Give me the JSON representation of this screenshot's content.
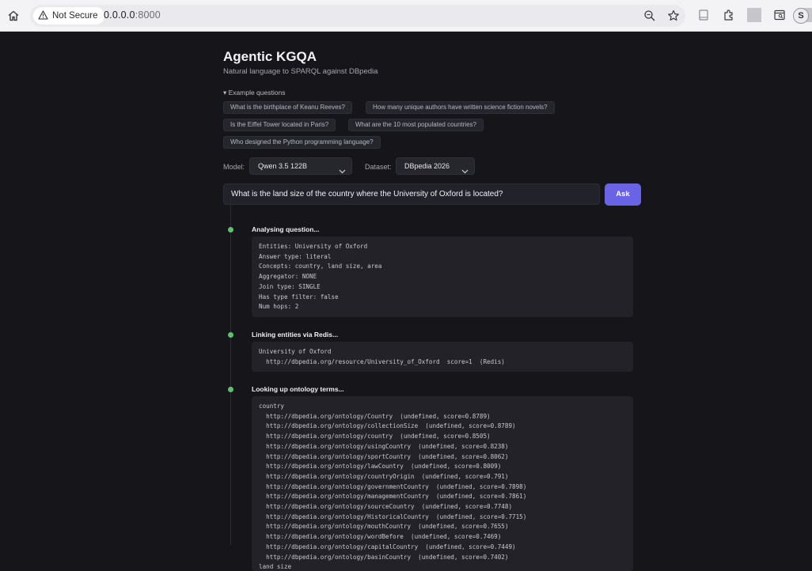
{
  "browser": {
    "security_label": "Not Secure",
    "url_host": "0.0.0.0",
    "url_port": ":8000",
    "profile_initial": "S"
  },
  "app": {
    "title": "Agentic KGQA",
    "subtitle": "Natural language to SPARQL against DBpedia"
  },
  "examples": {
    "toggle_label": "▾ Example questions",
    "items": [
      "What is the birthplace of Keanu Reeves?",
      "How many unique authors have written science fiction novels?",
      "Is the Eiffel Tower located in Paris?",
      "What are the 10 most populated countries?",
      "Who designed the Python programming language?"
    ]
  },
  "controls": {
    "model_label": "Model:",
    "model_value": "Qwen 3.5 122B",
    "dataset_label": "Dataset:",
    "dataset_value": "DBpedia 2026"
  },
  "query": {
    "value": "What is the land size of the country where the University of Oxford is located?",
    "ask_label": "Ask"
  },
  "steps": [
    {
      "title": "Analysing question...",
      "lines": [
        "Entities: University of Oxford",
        "Answer type: literal",
        "Concepts: country, land size, area",
        "Aggregator: NONE",
        "Join type: SINGLE",
        "Has type filter: false",
        "Num hops: 2"
      ]
    },
    {
      "title": "Linking entities via Redis...",
      "lines": [
        "University of Oxford",
        "  http://dbpedia.org/resource/University_of_Oxford  score=1  (Redis)"
      ]
    },
    {
      "title": "Looking up ontology terms...",
      "lines": [
        "country",
        "  http://dbpedia.org/ontology/Country  (undefined, score=0.8789)",
        "  http://dbpedia.org/ontology/collectionSize  (undefined, score=0.8789)",
        "  http://dbpedia.org/ontology/country  (undefined, score=0.8505)",
        "  http://dbpedia.org/ontology/usingCountry  (undefined, score=0.8238)",
        "  http://dbpedia.org/ontology/sportCountry  (undefined, score=0.8062)",
        "  http://dbpedia.org/ontology/lawCountry  (undefined, score=0.8009)",
        "  http://dbpedia.org/ontology/countryOrigin  (undefined, score=0.791)",
        "  http://dbpedia.org/ontology/governmentCountry  (undefined, score=0.7898)",
        "  http://dbpedia.org/ontology/managementCountry  (undefined, score=0.7861)",
        "  http://dbpedia.org/ontology/sourceCountry  (undefined, score=0.7748)",
        "  http://dbpedia.org/ontology/HistoricalCountry  (undefined, score=0.7715)",
        "  http://dbpedia.org/ontology/mouthCountry  (undefined, score=0.7655)",
        "  http://dbpedia.org/ontology/wordBefore  (undefined, score=0.7469)",
        "  http://dbpedia.org/ontology/capitalCountry  (undefined, score=0.7449)",
        "  http://dbpedia.org/ontology/basinCountry  (undefined, score=0.7402)",
        "land size"
      ]
    }
  ]
}
